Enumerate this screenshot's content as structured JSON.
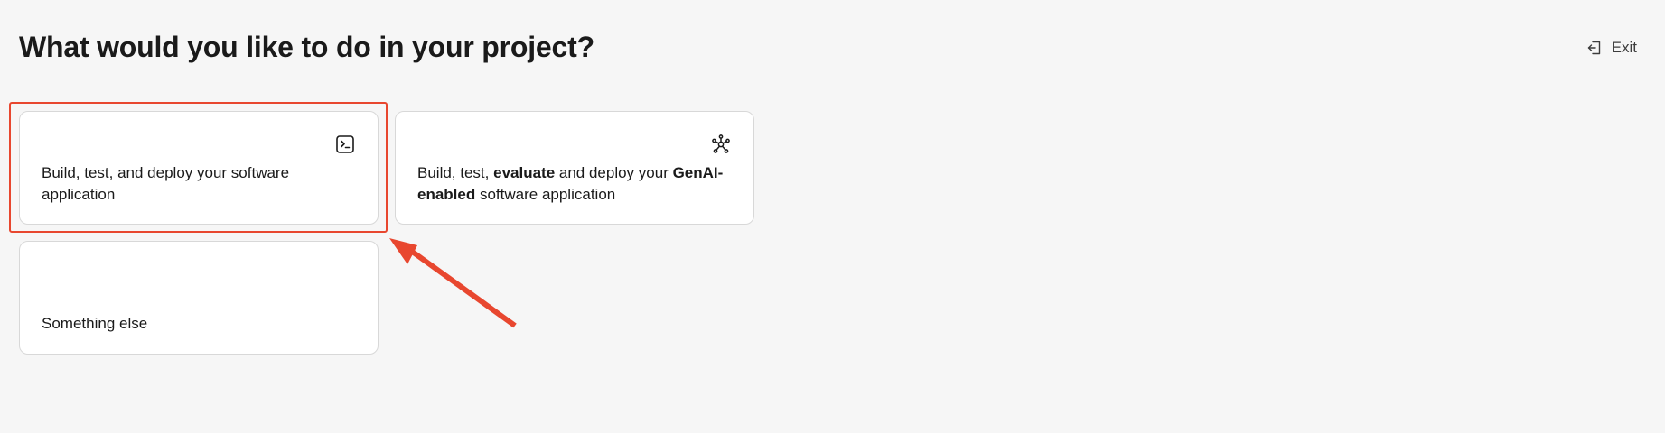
{
  "header": {
    "title": "What would you like to do in your project?",
    "exit_label": "Exit",
    "exit_icon": "exit-icon"
  },
  "cards": [
    {
      "id": "software",
      "icon": "terminal-icon",
      "text_segments": [
        {
          "text": "Build, test, and deploy your software application",
          "bold": false
        }
      ]
    },
    {
      "id": "genai",
      "icon": "network-icon",
      "text_segments": [
        {
          "text": "Build, test, ",
          "bold": false
        },
        {
          "text": "evaluate",
          "bold": true
        },
        {
          "text": " and deploy your ",
          "bold": false
        },
        {
          "text": "GenAI-enabled",
          "bold": true
        },
        {
          "text": " software application",
          "bold": false
        }
      ]
    },
    {
      "id": "other",
      "icon": "",
      "text_segments": [
        {
          "text": "Something else",
          "bold": false
        }
      ]
    }
  ],
  "annotation": {
    "color": "#e8472f",
    "highlighted_card": "software"
  }
}
